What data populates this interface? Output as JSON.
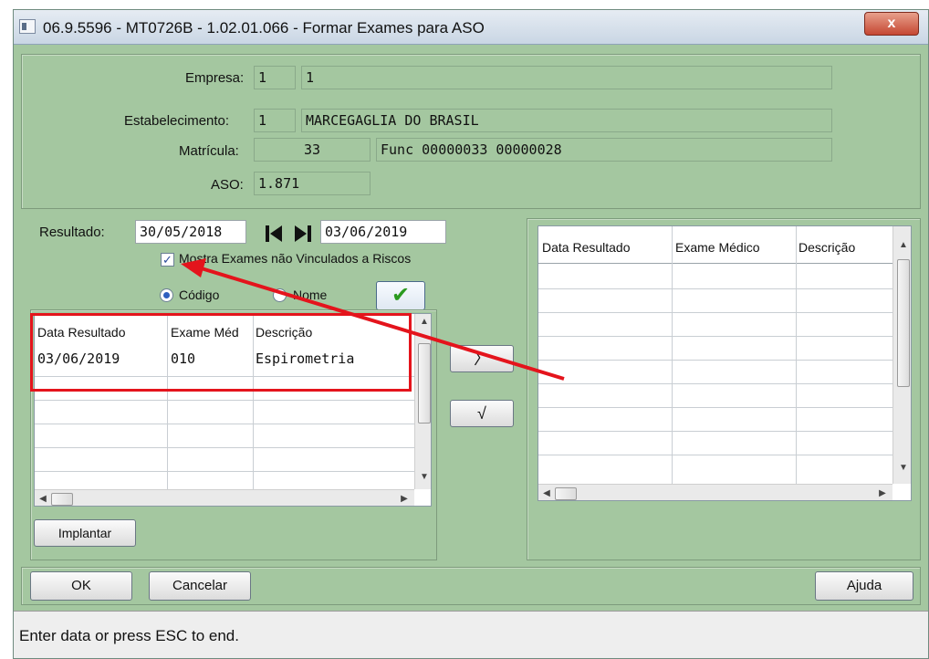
{
  "window": {
    "title": "06.9.5596 - MT0726B - 1.02.01.066 - Formar Exames para ASO",
    "close_glyph": "x"
  },
  "header": {
    "empresa_label": "Empresa:",
    "empresa_code": "1",
    "empresa_name": "1",
    "estab_label": "Estabelecimento:",
    "estab_code": "1",
    "estab_name": "MARCEGAGLIA DO BRASIL",
    "matricula_label": "Matrícula:",
    "matricula_value": "33",
    "matricula_name": "Func 00000033 00000028",
    "aso_label": "ASO:",
    "aso_value": "1.871"
  },
  "filter": {
    "resultado_label": "Resultado:",
    "date_from": "30/05/2018",
    "date_to": "03/06/2019",
    "mostra_label": "Mostra Exames não Vinculados a Riscos",
    "mostra_checked": "✓",
    "codigo_label": "Código",
    "nome_label": "Nome",
    "confirm_glyph": "✔"
  },
  "left_grid": {
    "headers": [
      "Data Resultado",
      "Exame Méd",
      "Descrição"
    ],
    "rows": [
      [
        "03/06/2019",
        "010",
        "Espirometria"
      ]
    ]
  },
  "right_grid": {
    "headers": [
      "Data Resultado",
      "Exame Médico",
      "Descrição"
    ]
  },
  "transfer": {
    "add_glyph": "〉",
    "remove_glyph": "√"
  },
  "buttons": {
    "implantar": "Implantar",
    "ok": "OK",
    "cancelar": "Cancelar",
    "ajuda": "Ajuda"
  },
  "status": {
    "text": "Enter data or press ESC to end."
  },
  "colors": {
    "window_bg": "#a4c7a0",
    "annotation": "#e4141c",
    "check_green": "#2a9a1f"
  }
}
